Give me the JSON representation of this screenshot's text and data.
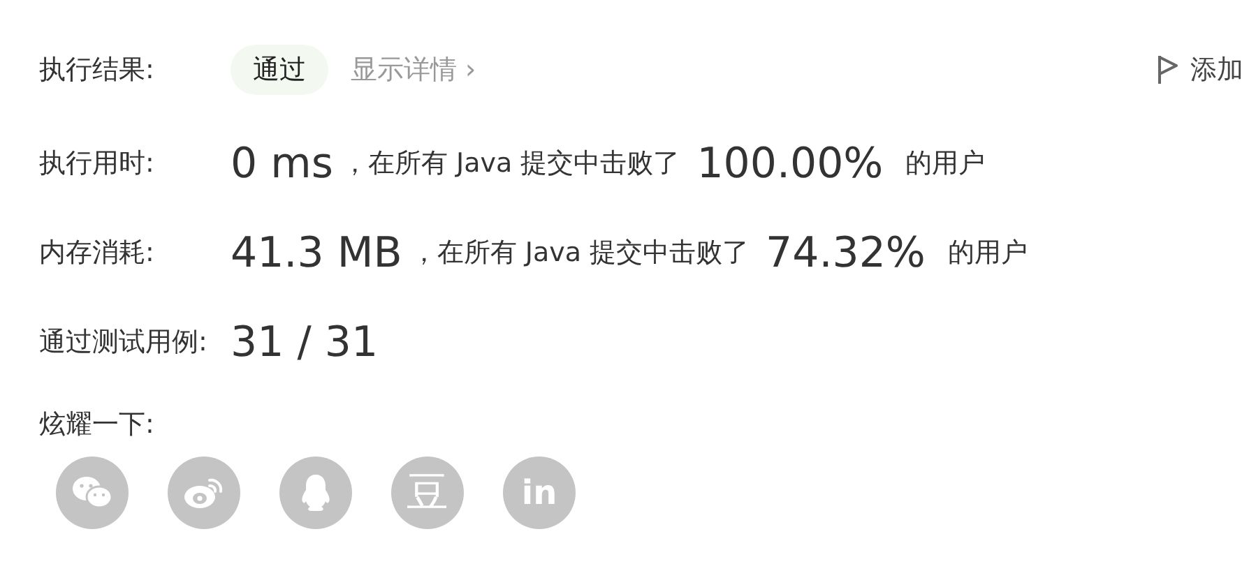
{
  "result": {
    "label": "执行结果:",
    "status": "通过",
    "details_link": "显示详情 ›",
    "add_button": "添加"
  },
  "stats": [
    {
      "label": "执行用时:",
      "value": "0 ms",
      "text": "，在所有 Java 提交中击败了",
      "percent": "100.00%",
      "suffix": "的用户"
    },
    {
      "label": "内存消耗:",
      "value": "41.3 MB",
      "text": "，在所有 Java 提交中击败了",
      "percent": "74.32%",
      "suffix": "的用户"
    },
    {
      "label": "通过测试用例:",
      "value": "31 / 31"
    }
  ],
  "share": {
    "label": "炫耀一下:",
    "items": [
      {
        "kind": "wechat"
      },
      {
        "kind": "weibo"
      },
      {
        "kind": "qq"
      },
      {
        "kind": "douban",
        "glyph": "豆"
      },
      {
        "kind": "linkedin",
        "glyph": "in"
      }
    ]
  }
}
